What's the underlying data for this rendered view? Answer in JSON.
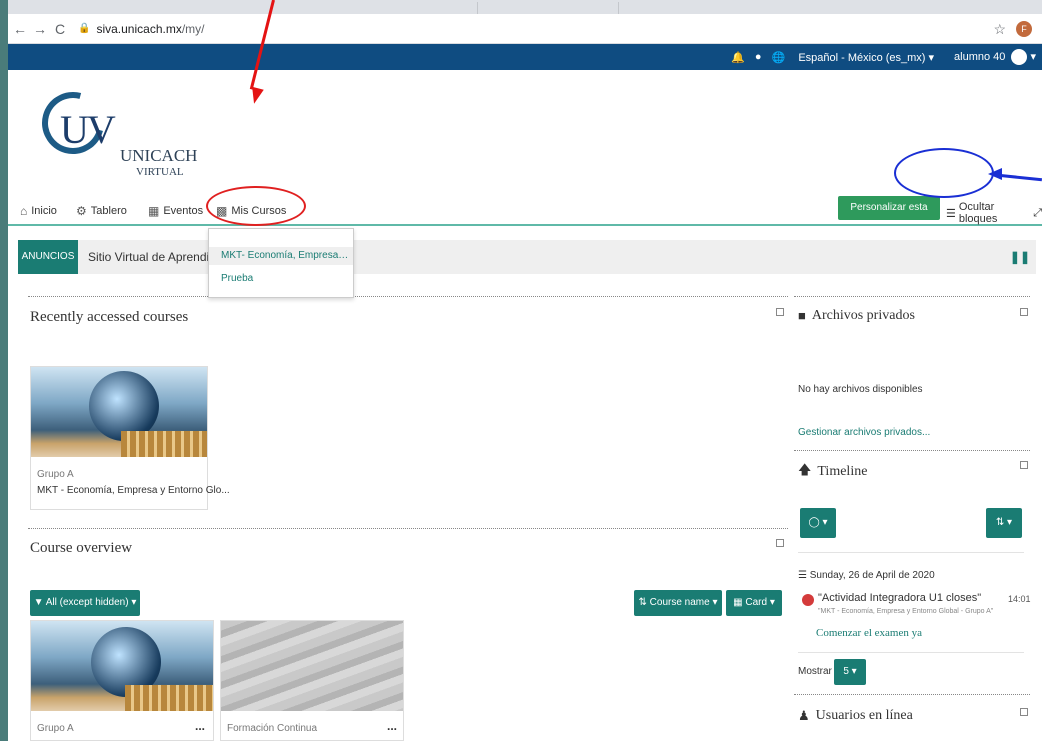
{
  "browser": {
    "url_domain": "siva.unicach.mx",
    "url_path": "/my/",
    "profile_initial": "F"
  },
  "topbar": {
    "language": "Español - México (es_mx)",
    "user": "alumno 40"
  },
  "logo": {
    "mark": "UV",
    "name": "UNICACH",
    "sub": "VIRTUAL"
  },
  "nav": {
    "items": [
      "Inicio",
      "Tablero",
      "Eventos",
      "Mis Cursos"
    ],
    "customize": "Personalizar esta página",
    "hide_blocks": "Ocultar bloques"
  },
  "news": {
    "badge": "ANUNCIOS",
    "text": "Sitio Virtual de Aprendizaje"
  },
  "dropdown": {
    "items": [
      "MKT- Economía, Empresas, Entor...",
      "Prueba"
    ]
  },
  "recent": {
    "title": "Recently accessed courses",
    "card": {
      "group": "Grupo A",
      "name": "MKT - Economía, Empresa y Entorno Glo..."
    }
  },
  "overview": {
    "title": "Course overview",
    "filter": "All (except hidden)",
    "sort": "Course name",
    "view": "Card",
    "cards": [
      {
        "category": "Grupo A",
        "more": "..."
      },
      {
        "category": "Formación Continua",
        "more": "..."
      }
    ]
  },
  "files": {
    "title": "Archivos privados",
    "empty": "No hay archivos disponibles",
    "manage": "Gestionar archivos privados..."
  },
  "timeline": {
    "title": "Timeline",
    "date": "Sunday, 26 de April de 2020",
    "event_title": "\"Actividad Integradora U1 closes\"",
    "event_time": "14:01",
    "event_course": "\"MKT - Economía, Empresa y Entorno Global - Grupo A\"",
    "action": "Comenzar el examen ya",
    "show_label": "Mostrar",
    "show_value": "5"
  },
  "online": {
    "title": "Usuarios en línea"
  },
  "colors": {
    "teal": "#1a7c73",
    "navy": "#0f4c81",
    "green": "#2e9a5c",
    "annotation_red": "#e02020",
    "annotation_blue": "#1a2fd4"
  }
}
